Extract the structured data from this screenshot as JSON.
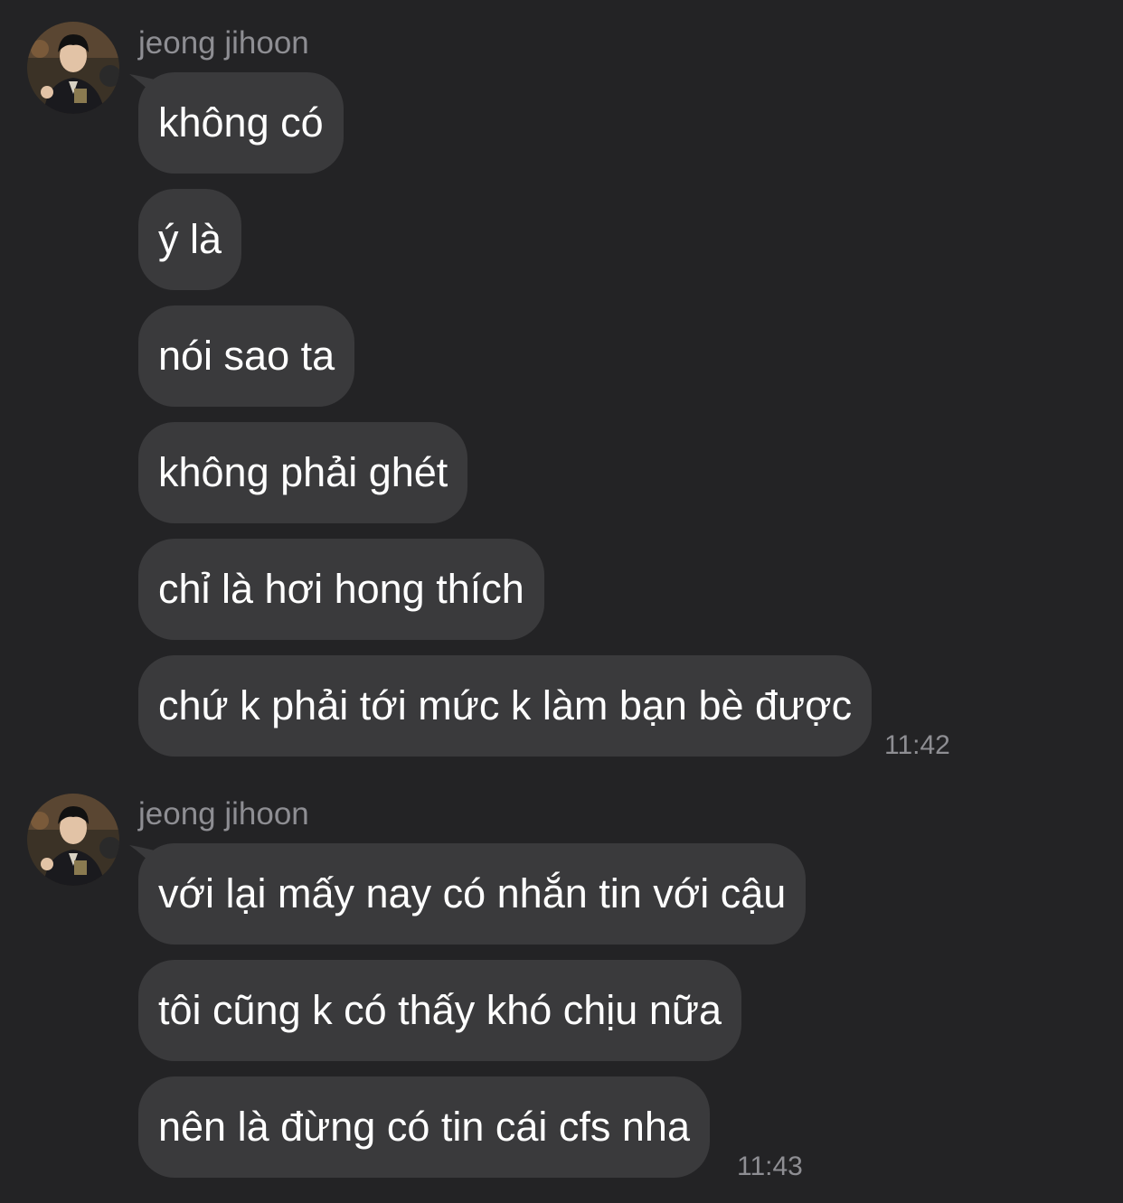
{
  "groups": [
    {
      "sender": "jeong jihoon",
      "messages": [
        "không có",
        "ý là",
        "nói sao ta",
        "không phải ghét",
        "chỉ là hơi hong thích",
        "chứ k phải tới mức k làm bạn bè được"
      ],
      "time": "11:42"
    },
    {
      "sender": "jeong jihoon",
      "messages": [
        "với lại mấy nay có nhắn tin với cậu",
        "tôi cũng k có thấy khó chịu nữa",
        "nên là đừng có tin cái cfs nha"
      ],
      "time": "11:43"
    }
  ],
  "colors": {
    "background": "#232325",
    "bubble": "#3a3a3c",
    "text": "#ffffff",
    "meta": "#8e8e93"
  },
  "icons": {
    "avatar": "profile-photo"
  }
}
